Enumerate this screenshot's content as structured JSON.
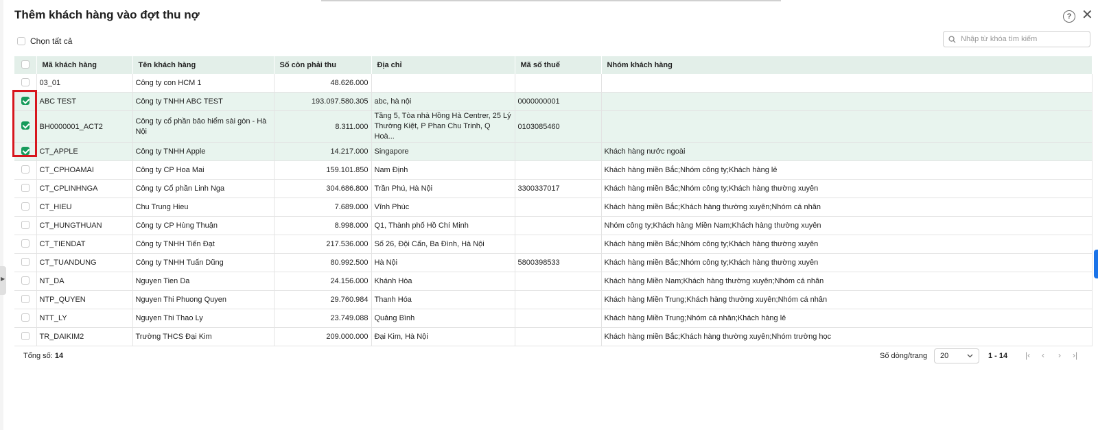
{
  "dialog": {
    "title": "Thêm khách hàng vào đợt thu nợ",
    "help_glyph": "?",
    "close_glyph": "✕",
    "select_all_label": "Chọn tất cả",
    "search_placeholder": "Nhập từ khóa tìm kiếm"
  },
  "table": {
    "columns": [
      "Mã khách hàng",
      "Tên khách hàng",
      "Số còn phải thu",
      "Địa chỉ",
      "Mã số thuế",
      "Nhóm khách hàng"
    ],
    "rows": [
      {
        "code": "03_01",
        "name": "Công ty con HCM 1",
        "amount": "48.626.000",
        "address": "",
        "tax": "",
        "group": "",
        "checked": false
      },
      {
        "code": "ABC TEST",
        "name": "Công ty TNHH ABC TEST",
        "amount": "193.097.580.305",
        "address": "abc, hà nội",
        "tax": "0000000001",
        "group": "",
        "checked": true
      },
      {
        "code": "BH0000001_ACT2",
        "name": "Công ty cổ phần bảo hiểm sài gòn - Hà Nội",
        "amount": "8.311.000",
        "address": "Tầng 5, Tòa nhà Hồng Hà Centrer, 25 Lý Thường Kiệt, P Phan Chu Trinh, Q Hoà...",
        "tax": "0103085460",
        "group": "",
        "checked": true
      },
      {
        "code": "CT_APPLE",
        "name": "Công ty TNHH Apple",
        "amount": "14.217.000",
        "address": "Singapore",
        "tax": "",
        "group": "Khách hàng nước ngoài",
        "checked": true
      },
      {
        "code": "CT_CPHOAMAI",
        "name": "Công ty CP Hoa Mai",
        "amount": "159.101.850",
        "address": "Nam Định",
        "tax": "",
        "group": "Khách hàng miền Bắc;Nhóm công ty;Khách hàng lẻ",
        "checked": false
      },
      {
        "code": "CT_CPLINHNGA",
        "name": "Công ty Cổ phần Linh Nga",
        "amount": "304.686.800",
        "address": "Trần Phú, Hà Nội",
        "tax": "3300337017",
        "group": "Khách hàng miền Bắc;Nhóm công ty;Khách hàng thường xuyên",
        "checked": false
      },
      {
        "code": "CT_HIEU",
        "name": "Chu Trung Hieu",
        "amount": "7.689.000",
        "address": "Vĩnh Phúc",
        "tax": "",
        "group": "Khách hàng miền Bắc;Khách hàng thường xuyên;Nhóm cá nhân",
        "checked": false
      },
      {
        "code": "CT_HUNGTHUAN",
        "name": "Công ty CP Hùng Thuận",
        "amount": "8.998.000",
        "address": "Q1, Thành phố Hồ Chí Minh",
        "tax": "",
        "group": "Nhóm công ty;Khách hàng Miền Nam;Khách hàng thường xuyên",
        "checked": false
      },
      {
        "code": "CT_TIENDAT",
        "name": "Công ty TNHH Tiến Đạt",
        "amount": "217.536.000",
        "address": "Số 26, Đội Cấn, Ba Đình, Hà Nội",
        "tax": "",
        "group": "Khách hàng miền Bắc;Nhóm công ty;Khách hàng thường xuyên",
        "checked": false
      },
      {
        "code": "CT_TUANDUNG",
        "name": "Công ty TNHH Tuấn Dũng",
        "amount": "80.992.500",
        "address": "Hà Nội",
        "tax": "5800398533",
        "group": "Khách hàng miền Bắc;Nhóm công ty;Khách hàng thường xuyên",
        "checked": false
      },
      {
        "code": "NT_DA",
        "name": "Nguyen Tien Da",
        "amount": "24.156.000",
        "address": "Khánh Hòa",
        "tax": "",
        "group": "Khách hàng Miền Nam;Khách hàng thường xuyên;Nhóm cá nhân",
        "checked": false
      },
      {
        "code": "NTP_QUYEN",
        "name": "Nguyen Thi Phuong Quyen",
        "amount": "29.760.984",
        "address": "Thanh Hóa",
        "tax": "",
        "group": "Khách hàng Miền Trung;Khách hàng thường xuyên;Nhóm cá nhân",
        "checked": false
      },
      {
        "code": "NTT_LY",
        "name": "Nguyen Thi Thao Ly",
        "amount": "23.749.088",
        "address": "Quảng Bình",
        "tax": "",
        "group": "Khách hàng Miền Trung;Nhóm cá nhân;Khách hàng lẻ",
        "checked": false
      },
      {
        "code": "TR_DAIKIM2",
        "name": "Trường THCS Đại Kim",
        "amount": "209.000.000",
        "address": "Đại Kim, Hà Nội",
        "tax": "",
        "group": "Khách hàng miền Bắc;Khách hàng thường xuyên;Nhóm trường học",
        "checked": false
      }
    ]
  },
  "footer": {
    "total_label": "Tổng số:",
    "total_value": "14",
    "rows_per_page_label": "Số dòng/trang",
    "rows_per_page_value": "20",
    "range_text": "1 - 14",
    "first_glyph": "|‹",
    "prev_glyph": "‹",
    "next_glyph": "›",
    "last_glyph": "›|"
  },
  "colors": {
    "accent": "#169b5b",
    "header_bg": "#e3efe9",
    "selected_row_bg": "#e8f4ee",
    "highlight": "#d7161d"
  }
}
